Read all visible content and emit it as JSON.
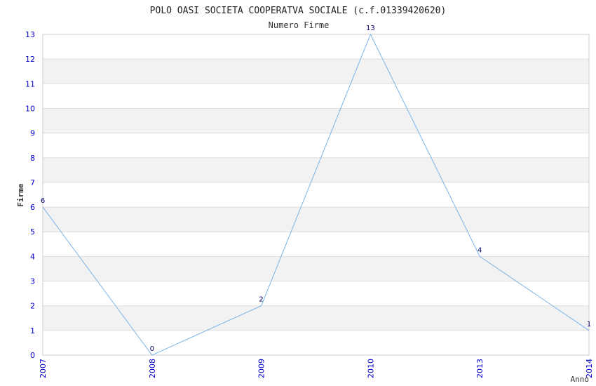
{
  "chart_data": {
    "type": "line",
    "title": "POLO OASI SOCIETA COOPERATVA SOCIALE (c.f.01339420620)",
    "subtitle": "Numero Firme",
    "xlabel": "Anno",
    "ylabel": "Firme",
    "x": [
      "2007",
      "2008",
      "2009",
      "2010",
      "2013",
      "2014"
    ],
    "series": [
      {
        "values": [
          6,
          0,
          2,
          13,
          4,
          1
        ]
      }
    ],
    "data_labels": [
      "6",
      "0",
      "2",
      "13",
      "4",
      "1"
    ],
    "y_ticks": [
      "0",
      "1",
      "2",
      "3",
      "4",
      "5",
      "6",
      "7",
      "8",
      "9",
      "10",
      "11",
      "12",
      "13"
    ],
    "ylim": [
      0,
      13
    ],
    "grid": true,
    "colors": {
      "line": "#7ab4e8",
      "tick_text": "#0000cc",
      "band": "#f2f2f2",
      "grid": "#dddddd",
      "title_text": "#222222",
      "data_label_text": "#000066"
    }
  }
}
